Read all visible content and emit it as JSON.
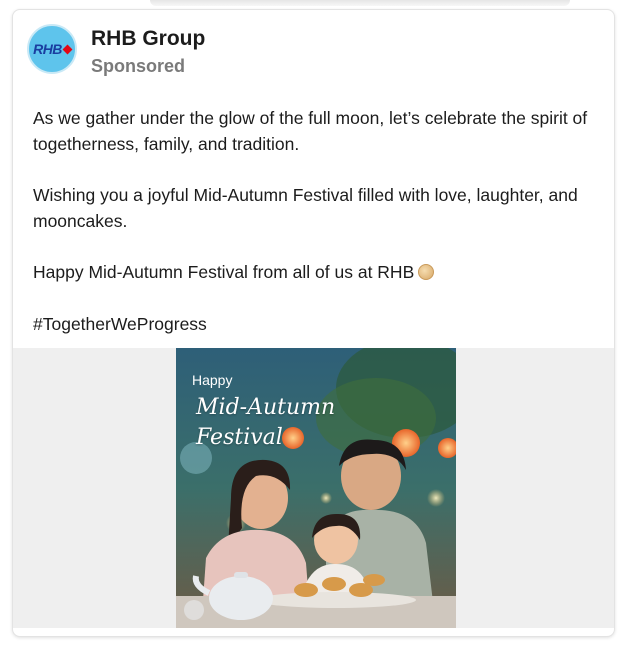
{
  "post": {
    "page_name": "RHB Group",
    "sponsored_label": "Sponsored",
    "avatar_logo": "RHB",
    "paragraphs": [
      "As we gather under the glow of the full moon, let’s celebrate the spirit of togetherness,  family, and tradition.",
      "Wishing you a joyful Mid-Autumn Festival filled with love, laughter, and mooncakes.",
      "Happy Mid-Autumn Festival from all of us at RHB",
      "#TogetherWeProgress"
    ],
    "emoji_icon": "mooncake-icon"
  },
  "image": {
    "happy": "Happy",
    "title_line1": "Mid-Autumn",
    "title_line2": "Festival"
  },
  "colors": {
    "avatar_bg": "#5ec4ec",
    "logo_blue": "#1a3ea0",
    "logo_red": "#e30613",
    "media_bg": "#efefef"
  }
}
